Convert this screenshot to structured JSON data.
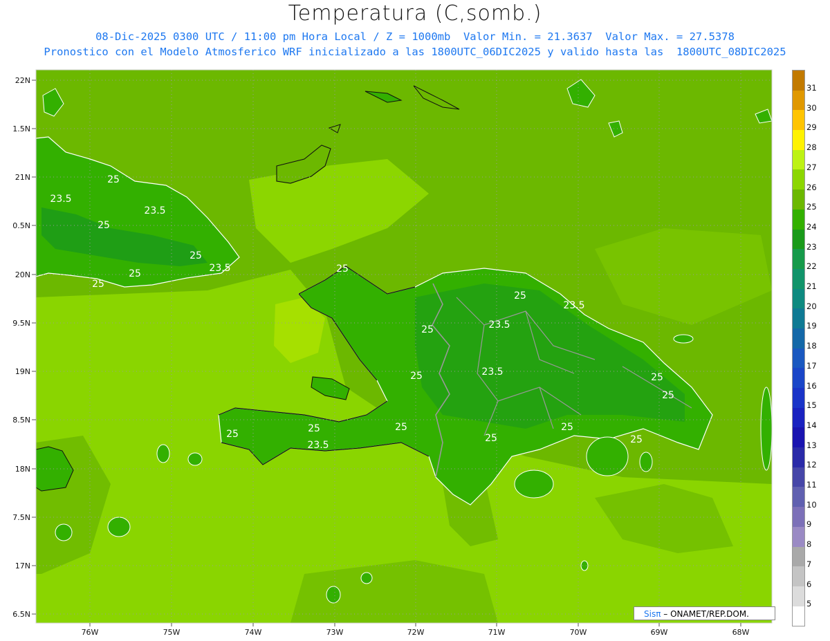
{
  "header": {
    "title": "Temperatura (C,somb.)",
    "line1": "08-Dic-2025 0300 UTC / 11:00 pm Hora Local / Z = 1000mb  Valor Min. = 21.3637  Valor Max. = 27.5378",
    "line2": "Pronostico con el Modelo Atmosferico WRF inicializado a las 1800UTC_06DIC2025 y valido hasta las  1800UTC_08DIC2025"
  },
  "axes": {
    "lat_labels": [
      "22N",
      "1.5N",
      "21N",
      "0.5N",
      "20N",
      "9.5N",
      "19N",
      "8.5N",
      "18N",
      "7.5N",
      "17N",
      "6.5N"
    ],
    "lon_labels": [
      "76W",
      "75W",
      "74W",
      "73W",
      "72W",
      "71W",
      "70W",
      "69W",
      "68W"
    ]
  },
  "colorbar": {
    "labels": [
      "31",
      "30",
      "29",
      "28",
      "27",
      "26",
      "25",
      "24",
      "23",
      "22",
      "21",
      "20",
      "19",
      "18",
      "17",
      "16",
      "15",
      "14",
      "13",
      "12",
      "11",
      "10",
      "9",
      "8",
      "7",
      "6",
      "5"
    ],
    "colors": [
      "#c27a00",
      "#e09800",
      "#ffc400",
      "#fff200",
      "#bdf214",
      "#8cd600",
      "#6cb800",
      "#33b000",
      "#1a9a1a",
      "#169a4a",
      "#11946a",
      "#0e8a80",
      "#0f7a94",
      "#1468a8",
      "#1a58c0",
      "#1a46c8",
      "#1a34c8",
      "#1a22c0",
      "#1a14b0",
      "#2a2aa8",
      "#4646a8",
      "#6060b0",
      "#7c70b8",
      "#9a8ac4",
      "#a9a9a9",
      "#c4c4c4",
      "#dcdcdc",
      "#ffffff"
    ]
  },
  "contour_labels": [
    "25",
    "23.5",
    "25",
    "23.5",
    "25",
    "23.5",
    "25",
    "25",
    "25",
    "25",
    "23.5",
    "23.5",
    "25",
    "25",
    "23.5",
    "25",
    "25",
    "25",
    "25",
    "23.5",
    "25",
    "25",
    "25",
    "25"
  ],
  "credit": {
    "brand": "Sisπ",
    "text": " – ONAMET/REP.DOM."
  }
}
